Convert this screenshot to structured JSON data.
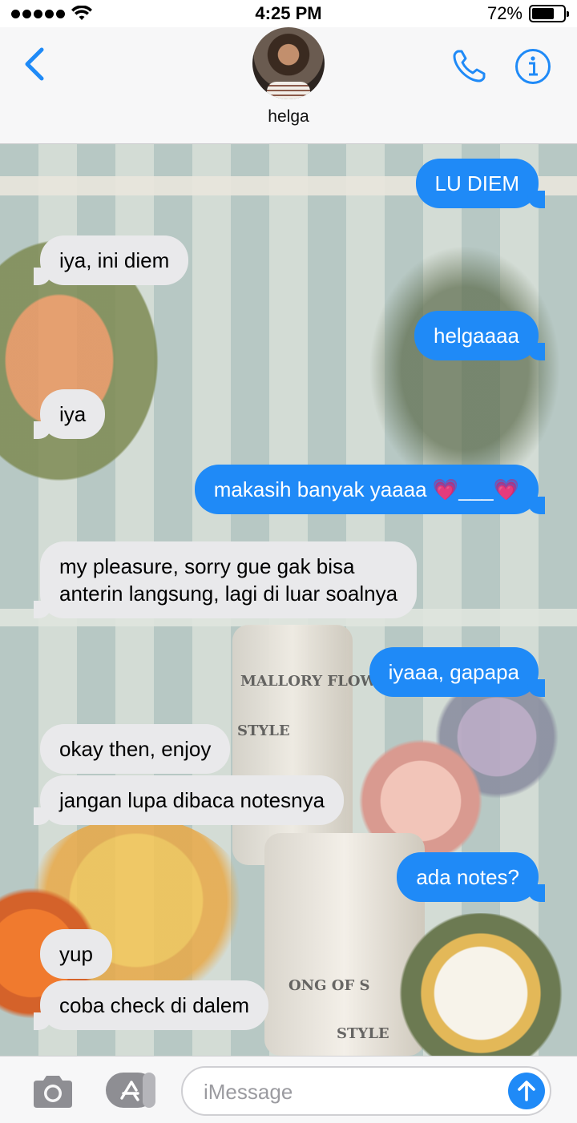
{
  "status_bar": {
    "time": "4:25 PM",
    "battery_text": "72%",
    "battery_level": 0.72,
    "signal_bars": 5
  },
  "header": {
    "contact_name": "helga"
  },
  "messages": [
    {
      "from": "me",
      "text": "LU DIEM"
    },
    {
      "from": "them",
      "text": "iya, ini diem"
    },
    {
      "from": "me",
      "text": "helgaaaa"
    },
    {
      "from": "them",
      "text": "iya"
    },
    {
      "from": "me",
      "text": "makasih banyak yaaaa 💗___💗"
    },
    {
      "from": "them",
      "text": "my pleasure, sorry gue gak bisa\nanterin langsung, lagi di luar soalnya"
    },
    {
      "from": "me",
      "text": "iyaaa, gapapa"
    },
    {
      "from": "them",
      "text": "okay then, enjoy"
    },
    {
      "from": "them",
      "text": "jangan lupa dibaca notesnya"
    },
    {
      "from": "me",
      "text": "ada notes?"
    },
    {
      "from": "them",
      "text": "yup"
    },
    {
      "from": "them",
      "text": "coba check di dalem"
    }
  ],
  "background_text": {
    "bucket_label_1": "MALLORY FLOWERS",
    "bucket_label_2": "STYLE",
    "bucket_label_3": "ONG OF S",
    "bucket_label_4": "STYLE"
  },
  "input_bar": {
    "placeholder": "iMessage",
    "value": ""
  },
  "colors": {
    "sent_bubble": "#1f8af7",
    "received_bubble": "#e9e9eb",
    "accent": "#1f8af7"
  },
  "icons": {
    "back": "chevron-left-icon",
    "phone": "phone-icon",
    "info": "info-icon",
    "camera": "camera-icon",
    "apps": "app-store-icon",
    "send": "arrow-up-icon"
  }
}
